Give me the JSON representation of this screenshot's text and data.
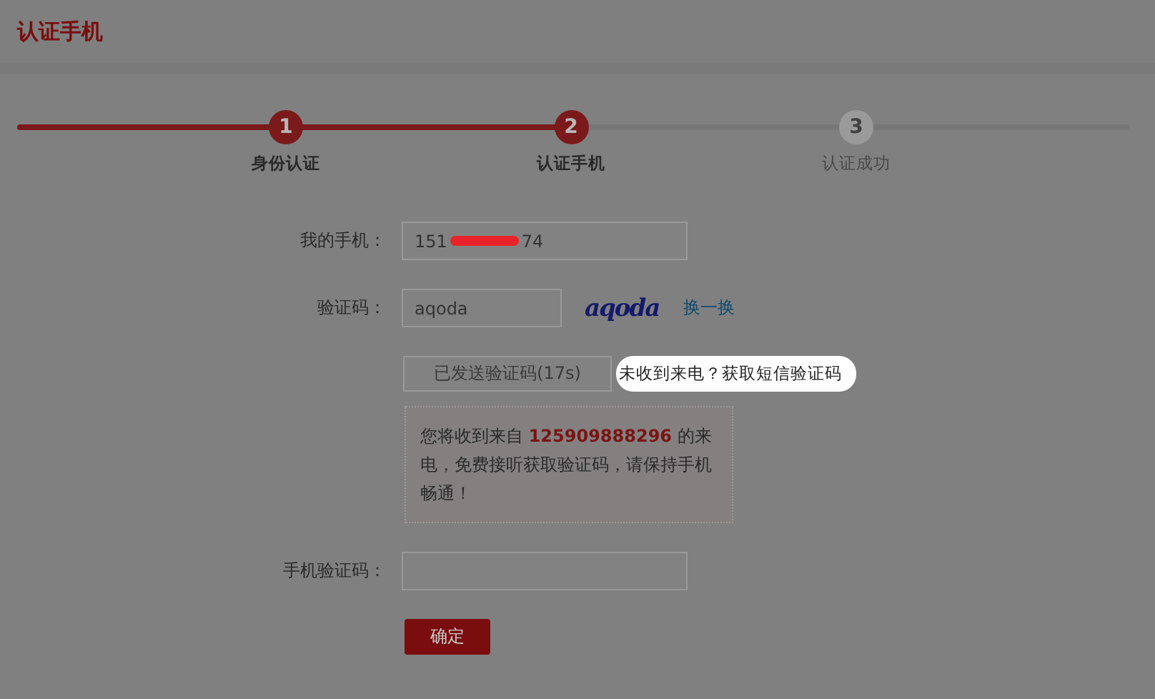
{
  "page_title": "认证手机",
  "steps": [
    {
      "number": "1",
      "label": "身份认证",
      "reached": true
    },
    {
      "number": "2",
      "label": "认证手机",
      "reached": true
    },
    {
      "number": "3",
      "label": "认证成功",
      "reached": false
    }
  ],
  "phone_field": {
    "label": "我的手机：",
    "value_start": "151",
    "value_end": "74",
    "redacted": true
  },
  "captcha_field": {
    "label": "验证码：",
    "value": "aqoda",
    "captcha_text": "aqoda",
    "refresh_link": "换一换"
  },
  "send_button": {
    "label": "已发送验证码(17s)",
    "disabled": true
  },
  "sms_link": {
    "label": "未收到来电？获取短信验证码",
    "highlighted": true
  },
  "info_note": "您将收到来自 **125909888296** 的来电，免费接听获取验证码，请保持手机畅通！",
  "code_field": {
    "label": "手机验证码："
  },
  "confirm_button": {
    "label": "确定"
  }
}
